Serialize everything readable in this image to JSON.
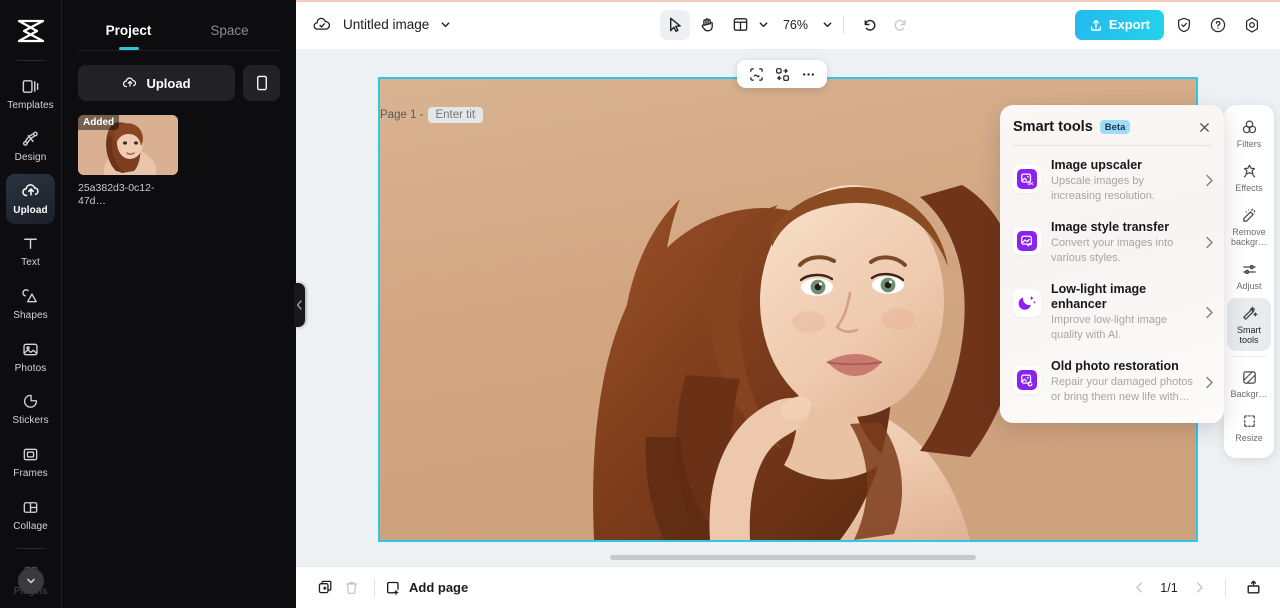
{
  "brand": {
    "accent": "#2ec8e6",
    "export_gradient_from": "#25b9f0",
    "export_gradient_to": "#23d3e8",
    "smart_icon_purple": "#8b22ef"
  },
  "rail": {
    "items": [
      {
        "label": "Templates",
        "icon": "templates-icon",
        "active": false
      },
      {
        "label": "Design",
        "icon": "design-icon",
        "active": false
      },
      {
        "label": "Upload",
        "icon": "upload-cloud-icon",
        "active": true
      },
      {
        "label": "Text",
        "icon": "text-icon",
        "active": false
      },
      {
        "label": "Shapes",
        "icon": "shapes-icon",
        "active": false
      },
      {
        "label": "Photos",
        "icon": "photos-icon",
        "active": false
      },
      {
        "label": "Stickers",
        "icon": "stickers-icon",
        "active": false
      },
      {
        "label": "Frames",
        "icon": "frames-icon",
        "active": false
      },
      {
        "label": "Collage",
        "icon": "collage-icon",
        "active": false
      },
      {
        "label": "Plugins",
        "icon": "plugins-icon",
        "active": false
      }
    ]
  },
  "panel": {
    "tabs": [
      {
        "label": "Project",
        "active": true
      },
      {
        "label": "Space",
        "active": false
      }
    ],
    "upload_label": "Upload",
    "asset": {
      "badge": "Added",
      "name": "25a382d3-0c12-47d…"
    }
  },
  "topbar": {
    "doc_title": "Untitled image",
    "zoom": "76%",
    "export_label": "Export",
    "tools": {
      "select": "cursor-select-icon",
      "hand": "hand-pan-icon",
      "layout": "layout-icon",
      "undo": "undo-icon",
      "redo": "redo-icon"
    }
  },
  "canvas": {
    "page_label": "Page 1 -",
    "page_title_placeholder": "Enter title",
    "float_tools": [
      "select-area-icon",
      "layers-icon",
      "more-options-icon"
    ]
  },
  "smart_tools": {
    "title": "Smart tools",
    "badge": "Beta",
    "items": [
      {
        "name": "Image upscaler",
        "desc": "Upscale images by increasing resolution.",
        "icon": "image-upscale-4k-icon"
      },
      {
        "name": "Image style transfer",
        "desc": "Convert your images into various styles.",
        "icon": "style-transfer-icon"
      },
      {
        "name": "Low-light image enhancer",
        "desc": "Improve low-light image quality with AI.",
        "icon": "moon-sparkle-icon"
      },
      {
        "name": "Old photo restoration",
        "desc": "Repair your damaged photos or bring them new life with…",
        "icon": "photo-restore-icon"
      }
    ]
  },
  "right_rail": {
    "items": [
      {
        "label": "Filters",
        "icon": "filters-icon",
        "active": false
      },
      {
        "label": "Effects",
        "icon": "effects-star-icon",
        "active": false
      },
      {
        "label": "Remove backgr…",
        "icon": "remove-background-icon",
        "active": false
      },
      {
        "label": "Adjust",
        "icon": "adjust-sliders-icon",
        "active": false
      },
      {
        "label": "Smart tools",
        "icon": "smart-tools-wand-icon",
        "active": true
      },
      {
        "label": "Backgr…",
        "icon": "background-icon",
        "active": false
      },
      {
        "label": "Resize",
        "icon": "resize-icon",
        "active": false
      }
    ]
  },
  "bottombar": {
    "add_page_label": "Add page",
    "page_indicator": "1/1",
    "duplicate_icon": "duplicate-page-icon",
    "delete_icon": "delete-page-icon",
    "present_icon": "present-icon"
  }
}
